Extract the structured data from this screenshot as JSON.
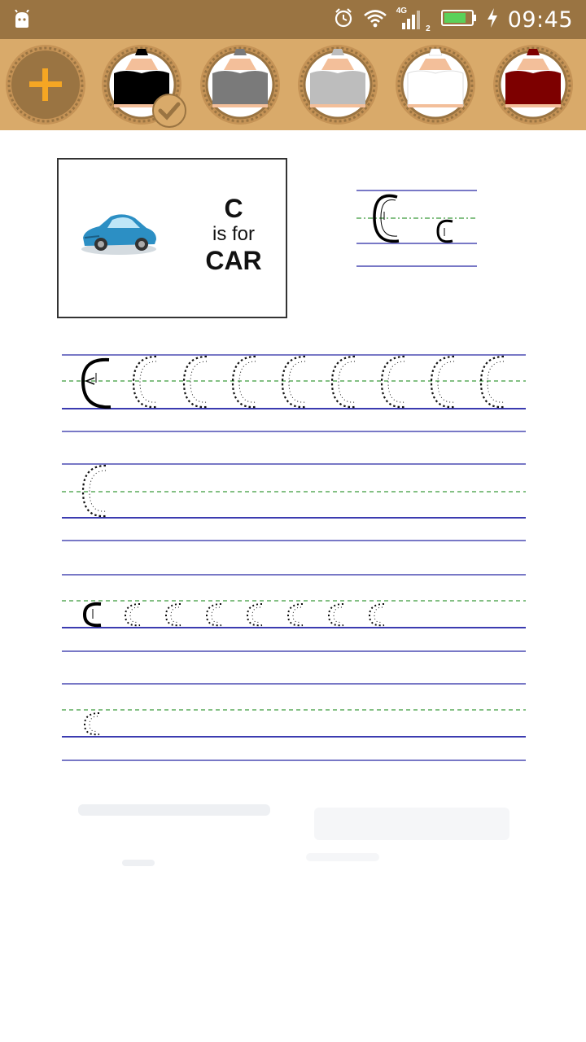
{
  "status_bar": {
    "time": "09:45",
    "network_label": "4G",
    "sim_label": "2",
    "icons": [
      "android-icon",
      "alarm-icon",
      "wifi-icon",
      "signal-icon",
      "battery-icon",
      "charging-icon"
    ]
  },
  "toolbar": {
    "add_icon": "plus-icon",
    "pencils": [
      {
        "name": "black",
        "color": "#000000",
        "selected": true
      },
      {
        "name": "dark-gray",
        "color": "#7a7a7a",
        "selected": false
      },
      {
        "name": "light-gray",
        "color": "#bdbdbd",
        "selected": false
      },
      {
        "name": "white",
        "color": "#ffffff",
        "selected": false
      },
      {
        "name": "dark-red",
        "color": "#7d0000",
        "selected": false
      }
    ]
  },
  "worksheet": {
    "letter": "C",
    "card_line1": "C",
    "card_line2": "is for",
    "card_line3": "CAR",
    "picture": "car-illustration"
  },
  "colors": {
    "status_bar": "#9a7442",
    "toolbar": "#d9aa6a",
    "accent_plus": "#f5a623",
    "ruled_line": "#4b4bb3",
    "dashed_line": "#3a9a3a"
  }
}
